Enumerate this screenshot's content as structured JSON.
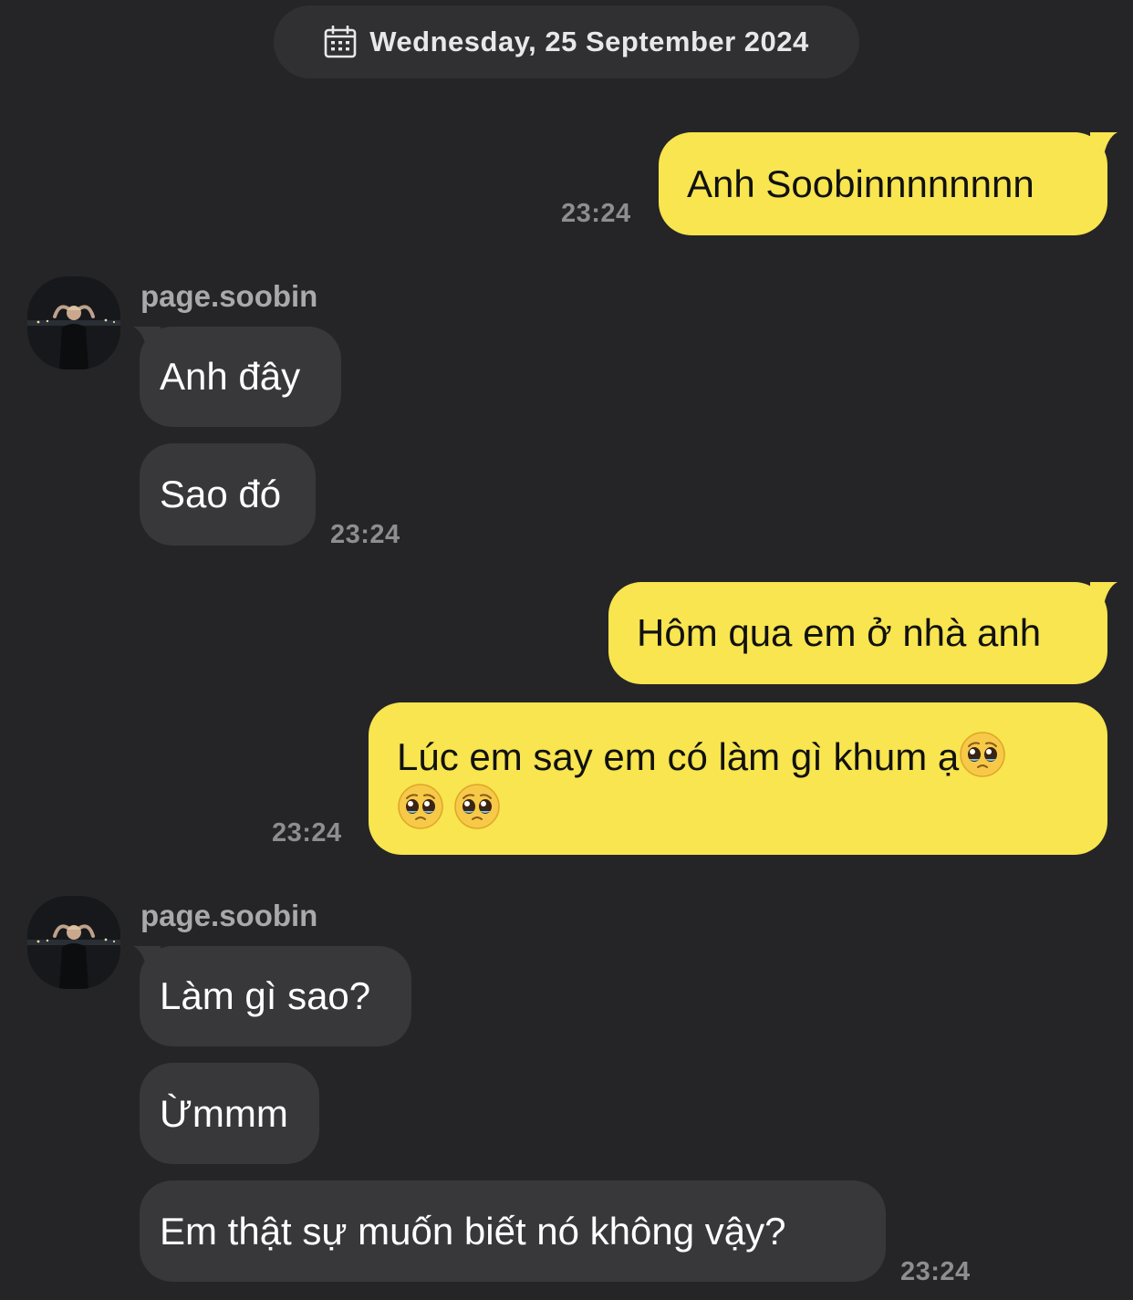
{
  "date_header": {
    "icon": "calendar-icon",
    "text": "Wednesday, 25 September 2024"
  },
  "colors": {
    "background": "#252527",
    "outgoing_bubble": "#f8e54f",
    "incoming_bubble": "#38383b",
    "timestamp": "#8d8d92",
    "sender_name": "#a9a9ad"
  },
  "messages": [
    {
      "direction": "out",
      "text": "Anh Soobinnnnnnnn",
      "time": "23:24"
    },
    {
      "direction": "in",
      "sender": "page.soobin",
      "text": "Anh đây"
    },
    {
      "direction": "in",
      "text": "Sao đó",
      "time": "23:24"
    },
    {
      "direction": "out",
      "text": "Hôm qua em ở nhà anh"
    },
    {
      "direction": "out",
      "text": "Lúc em say em có làm gì khum ạ",
      "emojis": [
        "pleading-face-emoji",
        "pleading-face-emoji",
        "pleading-face-emoji"
      ],
      "time": "23:24"
    },
    {
      "direction": "in",
      "sender": "page.soobin",
      "text": "Làm gì sao?"
    },
    {
      "direction": "in",
      "text": "Ừmmm"
    },
    {
      "direction": "in",
      "text": "Em thật sự muốn biết nó không vậy?",
      "time": "23:24"
    }
  ]
}
